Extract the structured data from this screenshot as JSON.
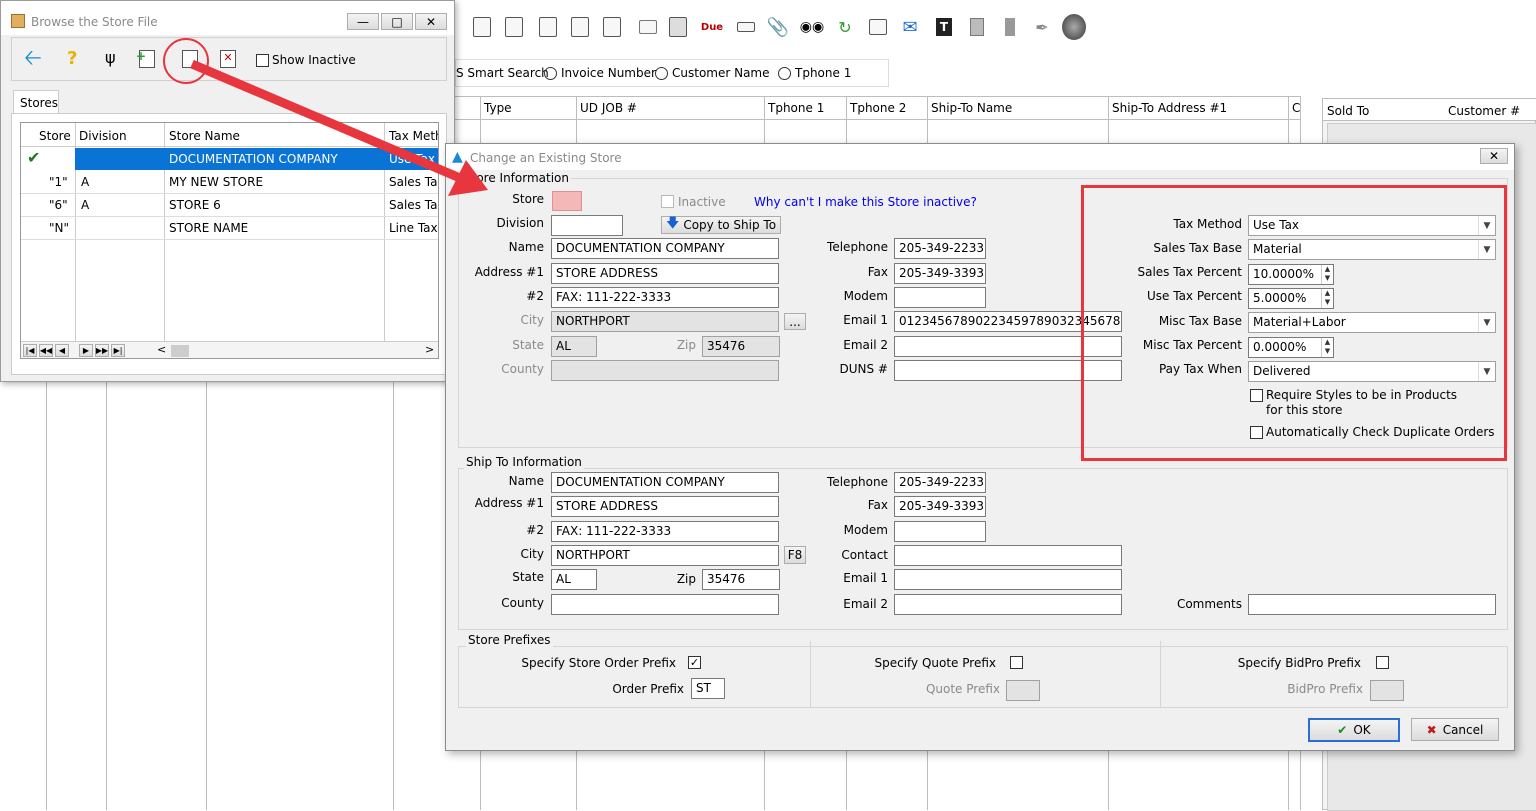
{
  "main": {
    "search": {
      "smart": "S Smart Search",
      "opts": [
        "Invoice Number",
        "Customer Name",
        "Tphone 1"
      ]
    },
    "columns": [
      "Type",
      "UD JOB #",
      "Tphone 1",
      "Tphone 2",
      "Ship-To Name",
      "Ship-To Address #1",
      "C"
    ],
    "right_panel": {
      "sold_to": "Sold To",
      "customer_no": "Customer #"
    }
  },
  "browse": {
    "title": "Browse the Store File",
    "show_inactive": "Show Inactive",
    "tab": "Stores",
    "headers": [
      "Store",
      "Division",
      "Store Name",
      "Tax Meth"
    ],
    "rows": [
      {
        "store": "\" \"",
        "division": "",
        "name": "DOCUMENTATION COMPANY",
        "tax": "Use Tax",
        "selected": true
      },
      {
        "store": "\"1\"",
        "division": "A",
        "name": "MY NEW STORE",
        "tax": "Sales Tax",
        "selected": false
      },
      {
        "store": "\"6\"",
        "division": "A",
        "name": "STORE 6",
        "tax": "Sales Tax",
        "selected": false
      },
      {
        "store": "\"N\"",
        "division": "",
        "name": "STORE NAME",
        "tax": "Line Tax",
        "selected": false
      }
    ]
  },
  "dialog": {
    "title": "Change an Existing Store",
    "store_info": {
      "title": "Store Information",
      "store_label": "Store",
      "inactive": "Inactive",
      "why_link": "Why can't I make this Store inactive?",
      "division_label": "Division",
      "copy_btn": "Copy to Ship To",
      "name_label": "Name",
      "name": "DOCUMENTATION COMPANY",
      "addr1_label": "Address #1",
      "addr1": "STORE ADDRESS",
      "addr2_label": "#2",
      "addr2": "FAX: 111-222-3333",
      "city_label": "City",
      "city": "NORTHPORT",
      "city_btn": "...",
      "state_label": "State",
      "state": "AL",
      "zip_label": "Zip",
      "zip": "35476",
      "county_label": "County",
      "tel_label": "Telephone",
      "tel": "205-349-2233",
      "fax_label": "Fax",
      "fax": "205-349-3393",
      "modem_label": "Modem",
      "email1_label": "Email 1",
      "email1": "01234567890223459789032345678",
      "email2_label": "Email 2",
      "duns_label": "DUNS #"
    },
    "tax": {
      "method_label": "Tax Method",
      "method": "Use Tax",
      "base_label": "Sales Tax Base",
      "base": "Material",
      "sales_pct_label": "Sales Tax Percent",
      "sales_pct": "10.0000%",
      "use_pct_label": "Use Tax Percent",
      "use_pct": "5.0000%",
      "misc_base_label": "Misc Tax Base",
      "misc_base": "Material+Labor",
      "misc_pct_label": "Misc Tax Percent",
      "misc_pct": "0.0000%",
      "pay_when_label": "Pay Tax When",
      "pay_when": "Delivered",
      "require_styles_1": "Require Styles to be in Products",
      "require_styles_2": "for this store",
      "auto_check": "Automatically Check Duplicate Orders"
    },
    "ship_to": {
      "title": "Ship To Information",
      "name_label": "Name",
      "name": "DOCUMENTATION COMPANY",
      "addr1_label": "Address #1",
      "addr1": "STORE ADDRESS",
      "addr2_label": "#2",
      "addr2": "FAX: 111-222-3333",
      "city_label": "City",
      "city": "NORTHPORT",
      "f8": "F8",
      "state_label": "State",
      "state": "AL",
      "zip_label": "Zip",
      "zip": "35476",
      "county_label": "County",
      "tel_label": "Telephone",
      "tel": "205-349-2233",
      "fax_label": "Fax",
      "fax": "205-349-3393",
      "modem_label": "Modem",
      "contact_label": "Contact",
      "email1_label": "Email 1",
      "email2_label": "Email 2",
      "comments_label": "Comments"
    },
    "prefixes": {
      "title": "Store Prefixes",
      "order_chk": "Specify Store Order Prefix",
      "order_label": "Order Prefix",
      "order_val": "ST",
      "quote_chk": "Specify Quote Prefix",
      "quote_label": "Quote Prefix",
      "bidpro_chk": "Specify BidPro Prefix",
      "bidpro_label": "BidPro Prefix"
    },
    "ok": "OK",
    "cancel": "Cancel"
  },
  "colors": {
    "highlight": "#e8363e",
    "selection": "#0a73d6",
    "link": "#0000ee"
  }
}
